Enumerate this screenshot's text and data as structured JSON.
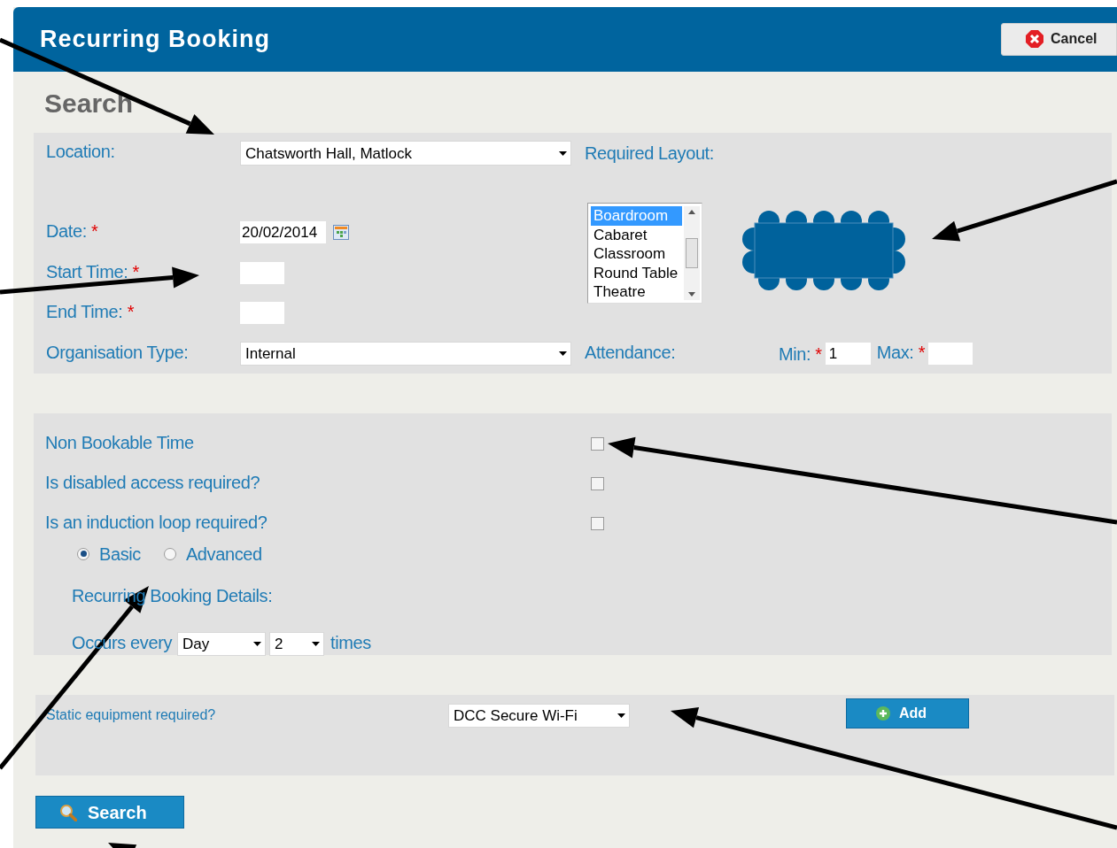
{
  "window": {
    "title": "Recurring Booking",
    "cancel_button": "Cancel"
  },
  "heading": "Search",
  "location": {
    "label": "Location:",
    "value": "Chatsworth Hall, Matlock"
  },
  "date": {
    "label": "Date:",
    "mark": "*",
    "value": "20/02/2014"
  },
  "start_time": {
    "label": "Start Time:",
    "mark": "*"
  },
  "end_time": {
    "label": "End Time:",
    "mark": "*"
  },
  "organisation_type": {
    "label": "Organisation Type:",
    "value": "Internal"
  },
  "layout": {
    "label": "Required Layout:",
    "options": [
      {
        "label": "Boardroom",
        "selected": true
      },
      {
        "label": "Cabaret",
        "selected": false
      },
      {
        "label": "Classroom",
        "selected": false
      },
      {
        "label": "Round Table",
        "selected": false
      },
      {
        "label": "Theatre",
        "selected": false
      }
    ]
  },
  "attendance": {
    "label": "Attendance:",
    "min_label": "Min:",
    "min_mark": "*",
    "min_value": "1",
    "max_label": "Max:",
    "max_mark": "*"
  },
  "options": [
    {
      "label": "Non Bookable Time",
      "checked": false
    },
    {
      "label": "Is disabled access required?",
      "checked": false
    },
    {
      "label": "Is an induction loop required?",
      "checked": false
    }
  ],
  "modes": [
    {
      "label": "Basic",
      "selected": true
    },
    {
      "label": "Advanced",
      "selected": false
    }
  ],
  "recurring": {
    "title": "Recurring Booking Details:",
    "prefix": "Occurs every",
    "period": "Day",
    "count": "2",
    "suffix": "times"
  },
  "equipment": {
    "label": "Static equipment required?",
    "value": "DCC Secure Wi-Fi",
    "add_button": "Add"
  },
  "search_button": "Search"
}
